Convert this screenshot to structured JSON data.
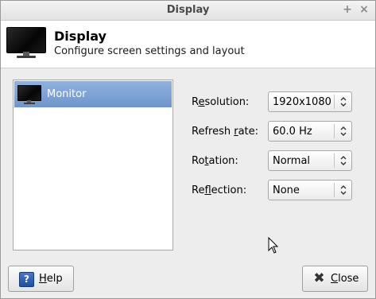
{
  "window": {
    "title": "Display",
    "controls": [
      "+",
      "×"
    ]
  },
  "header": {
    "title": "Display",
    "subtitle": "Configure screen settings and layout",
    "icon": "monitor-icon"
  },
  "monitors": [
    {
      "label": "Monitor",
      "selected": true,
      "icon": "monitor-icon"
    }
  ],
  "settings": {
    "resolution": {
      "label_pre": "R",
      "label_mn": "e",
      "label_post": "solution:",
      "value": "1920x1080"
    },
    "refresh_rate": {
      "label_pre": "Refresh ",
      "label_mn": "r",
      "label_post": "ate:",
      "value": "60.0 Hz"
    },
    "rotation": {
      "label_pre": "Ro",
      "label_mn": "t",
      "label_post": "ation:",
      "value": "Normal"
    },
    "reflection": {
      "label_pre": "Re",
      "label_mn": "f",
      "label_post": "lection:",
      "value": "None"
    }
  },
  "buttons": {
    "help": {
      "label_mn": "H",
      "label_post": "elp",
      "icon": "help-icon"
    },
    "close": {
      "label_mn": "C",
      "label_post": "lose",
      "icon": "close-icon"
    }
  },
  "colors": {
    "selection": "#7a9ed2",
    "help_icon": "#2a5cb0"
  }
}
